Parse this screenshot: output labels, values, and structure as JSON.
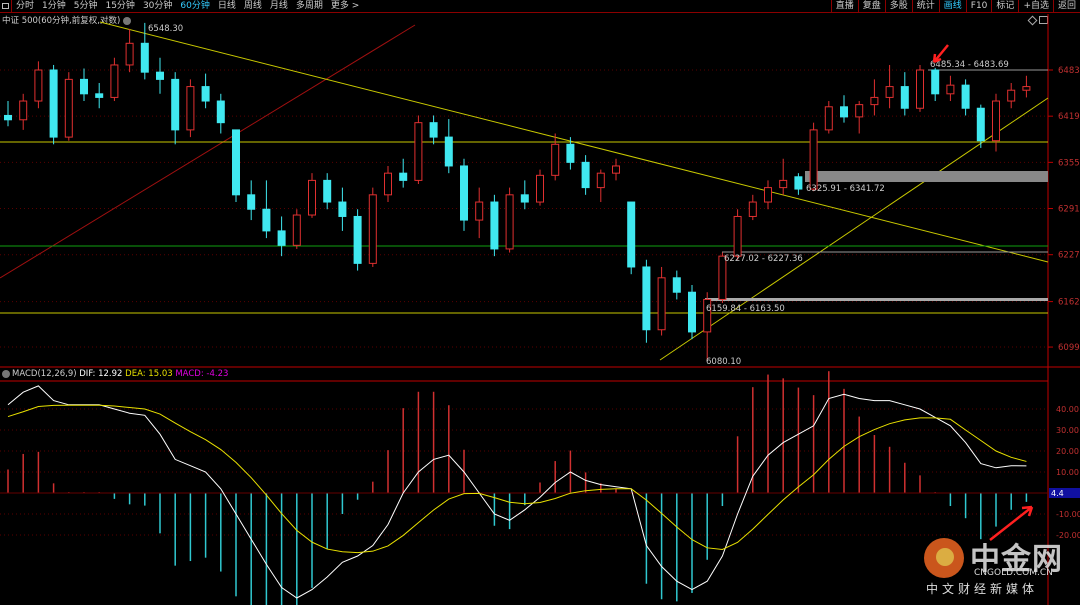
{
  "toolbar": {
    "periods": [
      "分时",
      "1分钟",
      "5分钟",
      "15分钟",
      "30分钟",
      "60分钟",
      "日线",
      "周线",
      "月线",
      "多周期",
      "更多 >"
    ],
    "active": "60分钟",
    "right": [
      "直播",
      "复盘",
      "多股",
      "统计",
      "画线",
      "F10",
      "标记",
      "+自选",
      "返回"
    ],
    "right_active": "画线"
  },
  "title": "中证 500(60分钟,前复权,对数)",
  "macd_label": {
    "name": "MACD(12,26,9)",
    "dif": "DIF: 12.92",
    "dea": "DEA: 15.03",
    "macd": "MACD: -4.23"
  },
  "colors": {
    "up": "#e03030",
    "down": "#40e8f0",
    "dif": "#ffffff",
    "dea": "#e8e000",
    "axis": "#c00000",
    "macd_label": "#e000e0"
  },
  "logo": {
    "name": "中金网",
    "domain": "CNGOLD.COM.CN",
    "tagline": "中文财经新媒体"
  },
  "chart_data": {
    "type": "candlestick",
    "price_ticks": [
      "6483",
      "6419",
      "6355",
      "6291",
      "6227",
      "6162",
      "6099"
    ],
    "price_tick_values": [
      6483,
      6419,
      6355,
      6291,
      6227,
      6162,
      6099
    ],
    "macd_ticks": [
      "40.00",
      "30.00",
      "20.00",
      "10.00",
      "-10.00",
      "-20.00"
    ],
    "macd_tick_values": [
      40,
      30,
      20,
      10,
      -10,
      -20
    ],
    "macd_current": "4.4",
    "annotations": {
      "high": "6548.30",
      "low": "6080.10",
      "zone1": "6485.34 - 6483.69",
      "zone2": "6325.91 - 6341.72",
      "zone3": "6227.02 - 6227.36",
      "zone4": "6159.84 - 6163.50"
    },
    "ohlc": [
      [
        6420,
        6440,
        6405,
        6414
      ],
      [
        6414,
        6450,
        6400,
        6440
      ],
      [
        6440,
        6495,
        6430,
        6483
      ],
      [
        6483,
        6490,
        6380,
        6390
      ],
      [
        6390,
        6480,
        6385,
        6470
      ],
      [
        6470,
        6485,
        6440,
        6450
      ],
      [
        6450,
        6465,
        6430,
        6445
      ],
      [
        6445,
        6500,
        6440,
        6490
      ],
      [
        6490,
        6540,
        6480,
        6520
      ],
      [
        6520,
        6548.3,
        6470,
        6480
      ],
      [
        6480,
        6500,
        6450,
        6470
      ],
      [
        6470,
        6480,
        6380,
        6400
      ],
      [
        6400,
        6470,
        6390,
        6460
      ],
      [
        6460,
        6478,
        6430,
        6440
      ],
      [
        6440,
        6450,
        6395,
        6410
      ],
      [
        6400,
        6400,
        6300,
        6310
      ],
      [
        6310,
        6330,
        6275,
        6290
      ],
      [
        6290,
        6330,
        6250,
        6260
      ],
      [
        6260,
        6280,
        6225,
        6240
      ],
      [
        6240,
        6290,
        6235,
        6282
      ],
      [
        6282,
        6340,
        6278,
        6330
      ],
      [
        6330,
        6340,
        6290,
        6300
      ],
      [
        6300,
        6320,
        6260,
        6280
      ],
      [
        6280,
        6290,
        6205,
        6215
      ],
      [
        6215,
        6320,
        6210,
        6310
      ],
      [
        6310,
        6350,
        6300,
        6340
      ],
      [
        6340,
        6360,
        6320,
        6330
      ],
      [
        6330,
        6420,
        6325,
        6410
      ],
      [
        6410,
        6420,
        6380,
        6390
      ],
      [
        6390,
        6415,
        6340,
        6350
      ],
      [
        6350,
        6360,
        6260,
        6275
      ],
      [
        6275,
        6320,
        6250,
        6300
      ],
      [
        6300,
        6310,
        6225,
        6235
      ],
      [
        6235,
        6320,
        6230,
        6310
      ],
      [
        6310,
        6330,
        6290,
        6300
      ],
      [
        6300,
        6345,
        6295,
        6337
      ],
      [
        6337,
        6395,
        6330,
        6380
      ],
      [
        6380,
        6390,
        6345,
        6355
      ],
      [
        6355,
        6365,
        6310,
        6320
      ],
      [
        6320,
        6345,
        6300,
        6340
      ],
      [
        6340,
        6360,
        6330,
        6350
      ],
      [
        6300,
        6300,
        6200,
        6210
      ],
      [
        6210,
        6220,
        6105,
        6123
      ],
      [
        6123,
        6210,
        6115,
        6195
      ],
      [
        6195,
        6205,
        6165,
        6175
      ],
      [
        6175,
        6185,
        6110,
        6120
      ],
      [
        6120,
        6175,
        6080.1,
        6165
      ],
      [
        6165,
        6230,
        6160,
        6225
      ],
      [
        6225,
        6290,
        6220,
        6280
      ],
      [
        6280,
        6310,
        6275,
        6300
      ],
      [
        6300,
        6330,
        6290,
        6320
      ],
      [
        6320,
        6360,
        6310,
        6330
      ],
      [
        6335,
        6340,
        6310,
        6318
      ],
      [
        6318,
        6410,
        6315,
        6400
      ],
      [
        6400,
        6440,
        6395,
        6432
      ],
      [
        6432,
        6448,
        6410,
        6418
      ],
      [
        6418,
        6440,
        6395,
        6435
      ],
      [
        6435,
        6470,
        6420,
        6445
      ],
      [
        6445,
        6490,
        6430,
        6460
      ],
      [
        6460,
        6480,
        6420,
        6430
      ],
      [
        6430,
        6490,
        6425,
        6483
      ],
      [
        6483,
        6486,
        6440,
        6450
      ],
      [
        6450,
        6475,
        6440,
        6462
      ],
      [
        6462,
        6470,
        6420,
        6430
      ],
      [
        6430,
        6435,
        6375,
        6385
      ],
      [
        6385,
        6450,
        6370,
        6440
      ],
      [
        6440,
        6465,
        6430,
        6455
      ],
      [
        6455,
        6475,
        6445,
        6460
      ]
    ],
    "dif": [
      42,
      48,
      51,
      44,
      42,
      42,
      42,
      40,
      38,
      37,
      28,
      16,
      13,
      10,
      2,
      -10,
      -22,
      -34,
      -45,
      -50,
      -46,
      -40,
      -33,
      -30,
      -25,
      -15,
      0,
      10,
      16,
      18,
      10,
      0,
      -10,
      -13,
      -8,
      -2,
      5,
      10,
      6,
      4,
      3,
      2,
      -25,
      -35,
      -42,
      -46,
      -42,
      -30,
      -10,
      8,
      18,
      24,
      28,
      32,
      45,
      47,
      45,
      44,
      44,
      42,
      40,
      36,
      32,
      24,
      14,
      12,
      13,
      12.92
    ],
    "dea": [
      36.4,
      38.7,
      41.2,
      41.7,
      41.8,
      41.8,
      41.8,
      41.4,
      40.7,
      40.0,
      37.6,
      33.3,
      29.2,
      25.4,
      20.7,
      14.6,
      7.3,
      -1.0,
      -9.8,
      -17.8,
      -23.4,
      -26.7,
      -28.0,
      -28.4,
      -27.7,
      -25.2,
      -20.2,
      -14.1,
      -8.1,
      -2.9,
      -0.3,
      -0.2,
      -2.2,
      -4.4,
      -5.1,
      -4.5,
      -2.6,
      -0.1,
      1.1,
      1.7,
      2.0,
      2.0,
      -3.4,
      -9.7,
      -16.2,
      -22.2,
      -26.1,
      -26.9,
      -23.5,
      -17.2,
      -10.2,
      -3.3,
      2.9,
      8.7,
      16.0,
      22.2,
      26.8,
      30.2,
      33.0,
      34.8,
      35.8,
      35.8,
      35.1,
      30,
      25,
      20,
      17,
      15.03
    ]
  }
}
